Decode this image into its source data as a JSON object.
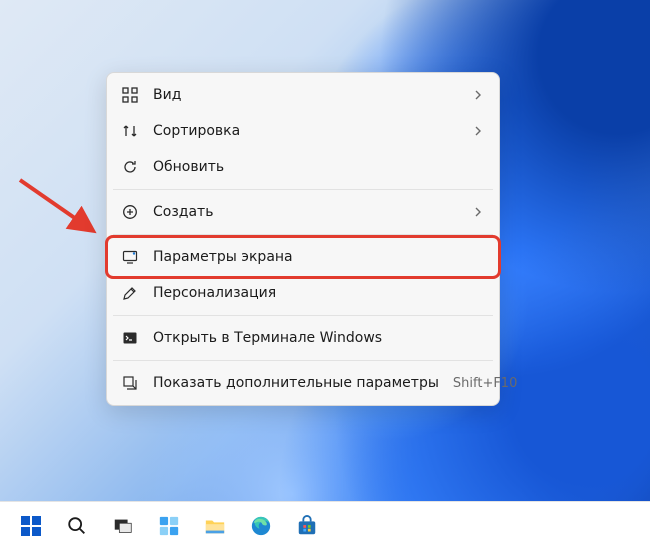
{
  "menu": {
    "items": [
      {
        "label": "Вид",
        "icon": "view",
        "submenu": true,
        "shortcut": ""
      },
      {
        "label": "Сортировка",
        "icon": "sort",
        "submenu": true,
        "shortcut": ""
      },
      {
        "label": "Обновить",
        "icon": "refresh",
        "submenu": false,
        "shortcut": ""
      },
      {
        "__sep": true
      },
      {
        "label": "Создать",
        "icon": "new",
        "submenu": true,
        "shortcut": ""
      },
      {
        "__sep": true
      },
      {
        "label": "Параметры экрана",
        "icon": "display",
        "submenu": false,
        "shortcut": "",
        "highlighted": true
      },
      {
        "label": "Персонализация",
        "icon": "personalize",
        "submenu": false,
        "shortcut": ""
      },
      {
        "__sep": true
      },
      {
        "label": "Открыть в Терминале Windows",
        "icon": "terminal",
        "submenu": false,
        "shortcut": ""
      },
      {
        "__sep": true
      },
      {
        "label": "Показать дополнительные параметры",
        "icon": "more",
        "submenu": false,
        "shortcut": "Shift+F10"
      }
    ]
  },
  "taskbar": {
    "items": [
      {
        "name": "start",
        "title": "Start"
      },
      {
        "name": "search",
        "title": "Search"
      },
      {
        "name": "task-view",
        "title": "Task View"
      },
      {
        "name": "widgets",
        "title": "Widgets"
      },
      {
        "name": "file-explorer",
        "title": "File Explorer"
      },
      {
        "name": "edge",
        "title": "Microsoft Edge"
      },
      {
        "name": "store",
        "title": "Microsoft Store"
      }
    ]
  }
}
